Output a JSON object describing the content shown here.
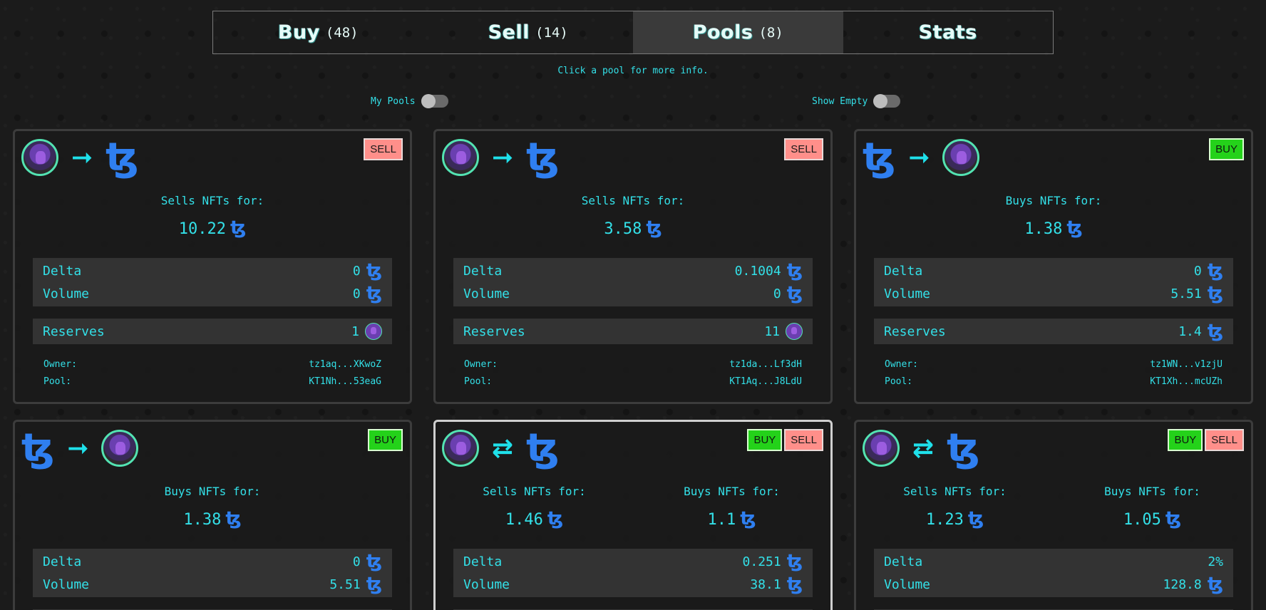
{
  "tabs": [
    {
      "label": "Buy",
      "count": "(48)"
    },
    {
      "label": "Sell",
      "count": "(14)"
    },
    {
      "label": "Pools",
      "count": "(8)"
    },
    {
      "label": "Stats",
      "count": ""
    }
  ],
  "hint": "Click a pool for more info.",
  "toggles": {
    "my_pools": "My Pools",
    "show_empty": "Show Empty"
  },
  "labels": {
    "sells_for": "Sells NFTs for:",
    "buys_for": "Buys NFTs for:",
    "delta": "Delta",
    "volume": "Volume",
    "reserves": "Reserves",
    "owner": "Owner:",
    "pool": "Pool:",
    "buy": "BUY",
    "sell": "SELL"
  },
  "cards": [
    {
      "sells": "10.22",
      "delta": "0",
      "volume": "0",
      "reserves": "1",
      "owner": "tz1aq...XKwoZ",
      "pool": "KT1Nh...53eaG"
    },
    {
      "sells": "3.58",
      "delta": "0.1004",
      "volume": "0",
      "reserves": "11",
      "owner": "tz1da...Lf3dH",
      "pool": "KT1Aq...J8LdU"
    },
    {
      "buys": "1.38",
      "delta": "0",
      "volume": "5.51",
      "reserves": "1.4",
      "owner": "tz1WN...v1zjU",
      "pool": "KT1Xh...mcUZh"
    },
    {
      "buys": "1.38",
      "delta": "0",
      "volume": "5.51"
    },
    {
      "sells": "1.46",
      "buys": "1.1",
      "delta": "0.251",
      "volume": "38.1"
    },
    {
      "sells": "1.23",
      "buys": "1.05",
      "delta": "2%",
      "volume": "128.8"
    }
  ],
  "tez_symbol": "ꜩ",
  "arrow_right": "➞",
  "arrow_swap": "⇄",
  "colors": {
    "accent": "#33e0e8",
    "tez": "#2f7ff0",
    "buy": "#24d21a",
    "sell": "#ff8f8a"
  }
}
